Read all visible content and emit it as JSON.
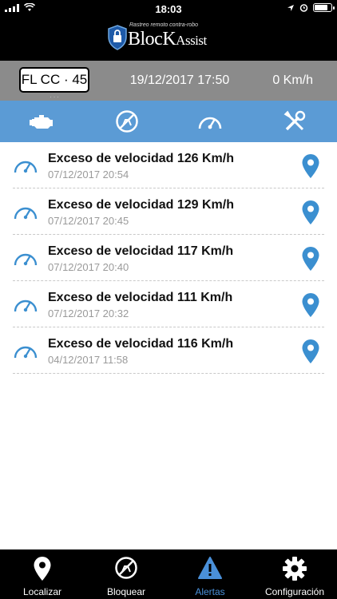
{
  "status_bar": {
    "time": "18:03"
  },
  "brand": {
    "tagline": "Rastreo remoto contra-robo",
    "name_main": "BlocK",
    "name_sub": "Assist"
  },
  "info": {
    "plate": "FL CC · 45",
    "datetime": "19/12/2017 17:50",
    "speed": "0 Km/h"
  },
  "tabs": [
    {
      "icon": "engine-icon"
    },
    {
      "icon": "no-entry-icon"
    },
    {
      "icon": "speedometer-icon"
    },
    {
      "icon": "tools-icon"
    }
  ],
  "alerts": [
    {
      "title": "Exceso de velocidad 126 Km/h",
      "date": "07/12/2017 20:54"
    },
    {
      "title": "Exceso de velocidad 129 Km/h",
      "date": "07/12/2017 20:45"
    },
    {
      "title": "Exceso de velocidad 117 Km/h",
      "date": "07/12/2017 20:40"
    },
    {
      "title": "Exceso de velocidad 111 Km/h",
      "date": "07/12/2017 20:32"
    },
    {
      "title": "Exceso de velocidad 116 Km/h",
      "date": "04/12/2017 11:58"
    }
  ],
  "nav": [
    {
      "label": "Localizar",
      "icon": "location-pin-icon"
    },
    {
      "label": "Bloquear",
      "icon": "block-icon"
    },
    {
      "label": "Alertas",
      "icon": "warning-icon",
      "active": true
    },
    {
      "label": "Configuración",
      "icon": "gear-icon"
    }
  ],
  "colors": {
    "accent": "#5b9bd5",
    "active_nav": "#4a90d9",
    "pin": "#3b8fd0"
  }
}
